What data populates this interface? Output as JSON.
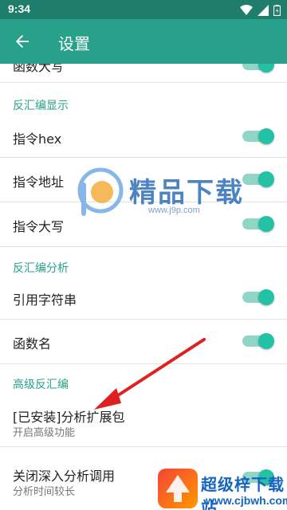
{
  "status_bar": {
    "time": "9:34"
  },
  "app_bar": {
    "title": "设置"
  },
  "items": {
    "partial_top": "函数大写",
    "section_disasm_display": "反汇编显示",
    "instr_hex": "指令hex",
    "instr_addr": "指令地址",
    "instr_upper": "指令大写",
    "section_disasm_analysis": "反汇编分析",
    "ref_string": "引用字符串",
    "func_name": "函数名",
    "section_advanced": "高级反汇编",
    "ext_pack_title": "[已安装]分析扩展包",
    "ext_pack_sub": "开启高级功能",
    "deep_analysis_title": "关闭深入分析调用",
    "deep_analysis_sub": "分析时间较长"
  },
  "watermark": {
    "text": "精品下载",
    "url": "www.j9p.com"
  },
  "brand": {
    "name": "超级梓下载站",
    "url": "www.cjbwh.com"
  },
  "colors": {
    "app_bar": "#28a18a",
    "status_bar": "#1f7d6b",
    "accent": "#23c2a4",
    "arrow": "#e02020"
  }
}
